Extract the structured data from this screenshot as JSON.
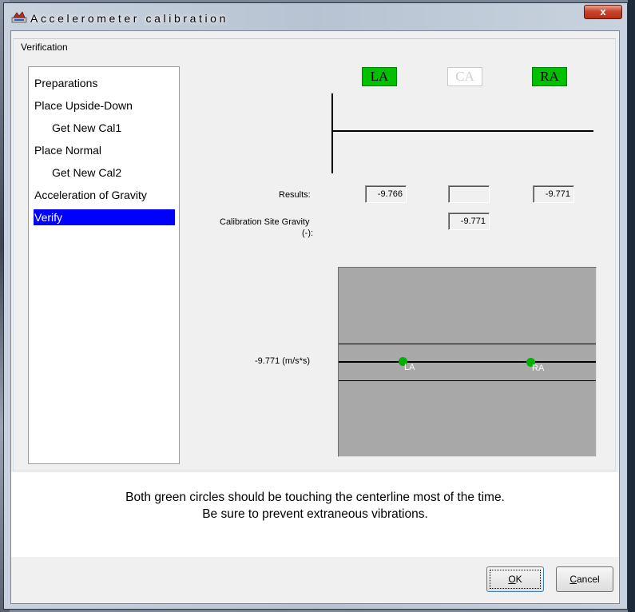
{
  "window": {
    "title": "Accelerometer calibration",
    "close_glyph": "x"
  },
  "group": {
    "legend": "Verification"
  },
  "steps": [
    {
      "label": "Preparations",
      "indent": false,
      "selected": false
    },
    {
      "label": "Place Upside-Down",
      "indent": false,
      "selected": false
    },
    {
      "label": "Get New Cal1",
      "indent": true,
      "selected": false
    },
    {
      "label": "Place Normal",
      "indent": false,
      "selected": false
    },
    {
      "label": "Get New Cal2",
      "indent": true,
      "selected": false
    },
    {
      "label": "Acceleration of Gravity",
      "indent": false,
      "selected": false
    },
    {
      "label": "Verify",
      "indent": false,
      "selected": true
    }
  ],
  "channels": {
    "la": {
      "label": "LA",
      "active": true
    },
    "ca": {
      "label": "CA",
      "active": false
    },
    "ra": {
      "label": "RA",
      "active": true
    }
  },
  "results": {
    "label": "Results:",
    "la": "-9.766",
    "ca": "",
    "ra": "-9.771"
  },
  "site_gravity": {
    "label": "Calibration Site Gravity",
    "sub_label": "(-):",
    "value": "-9.771"
  },
  "plot": {
    "center_label": "-9.771 (m/s*s)",
    "la_label": "LA",
    "ra_label": "RA"
  },
  "message": {
    "line1": "Both green circles should be touching the centerline most of the time.",
    "line2": "Be sure to prevent extraneous vibrations."
  },
  "buttons": {
    "ok_accel": "O",
    "ok_rest": "K",
    "cancel_accel": "C",
    "cancel_rest": "ancel"
  },
  "colors": {
    "channel_active": "#00c000",
    "selection": "#0000ff",
    "plot_background": "#a8a8a8",
    "dot": "#00b000"
  },
  "icons": {
    "app": "accelerometer-app-icon",
    "close": "close-icon"
  }
}
